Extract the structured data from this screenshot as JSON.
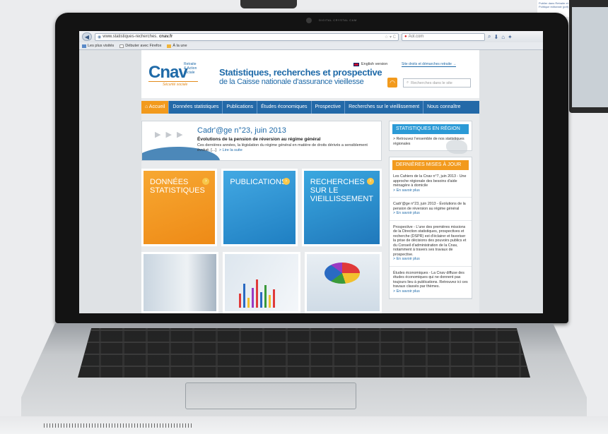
{
  "background_page": {
    "links": [
      "Publier dans Retraite et société",
      "Politique éditoriale (pdf)"
    ]
  },
  "laptop": {
    "camera_label": "DIGITAL CRYSTAL CAM"
  },
  "browser": {
    "url_prefix": "www.statistiques-recherches.",
    "url_domain": "cnav.fr",
    "search_placeholder": "Aol.com",
    "bookmarks": [
      "Les plus visités",
      "Débuter avec Firefox",
      "À la une"
    ]
  },
  "site": {
    "logo": {
      "brand": "Cnav",
      "tagline_1": "Retraite",
      "tagline_2": "& Action",
      "tagline_3": "sociale",
      "org": "Sécurité sociale"
    },
    "header_title": "Statistiques, recherches et prospective",
    "header_subtitle": "de la Caisse nationale d'assurance vieillesse",
    "english_link": "English version",
    "droits_link": "Site droits et démarches retraite →",
    "search_placeholder": "Recherches dans le site",
    "nav": [
      "Accueil",
      "Données statistiques",
      "Publications",
      "Études économiques",
      "Prospective",
      "Recherches sur le vieillissement",
      "Nous connaître"
    ],
    "banner": {
      "title": "Cadr'@ge n°23, juin 2013",
      "subtitle": "Évolutions de la pension de réversion au régime général",
      "text": "Ces dernières années, la législation du régime général en matière de droits dérivés a sensiblement évolué. [...]",
      "link": "> Lire la suite"
    },
    "tiles": [
      {
        "label": "DONNÉES STATISTIQUES"
      },
      {
        "label": "PUBLICATIONS"
      },
      {
        "label": "RECHERCHES SUR LE VIEILLISSEMENT"
      }
    ],
    "sidebar": {
      "region_title": "STATISTIQUES EN RÉGION",
      "region_text": "> Retrouvez l'ensemble de nos statistiques régionales",
      "updates_title": "DERNIÈRES MISES À JOUR",
      "updates": [
        {
          "text": "Les Cahiers de la Cnav n°7, juin 2013 - Une approche régionale des besoins d'aide ménagère à domicile",
          "more": "> En savoir plus"
        },
        {
          "text": "Cadr'@ge n°23, juin 2013 - Évolutions de la pension de réversion au régime général",
          "more": "> En savoir plus"
        },
        {
          "text": "Prospective - L'une des premières missions de la Direction statistiques, prospectives et recherche (DSPR) est d'éclairer et favoriser la prise de décisions des pouvoirs publics et du Conseil d'administration de la Cnav, notamment à travers ses travaux de prospective.",
          "more": "> En savoir plus"
        },
        {
          "text": "Études économiques - La Cnav diffuse des études économiques qui ne donnent pas toujours lieu à publications. Retrouvez ici ces travaux classés par thèmes.",
          "more": "> En savoir plus"
        }
      ]
    }
  }
}
